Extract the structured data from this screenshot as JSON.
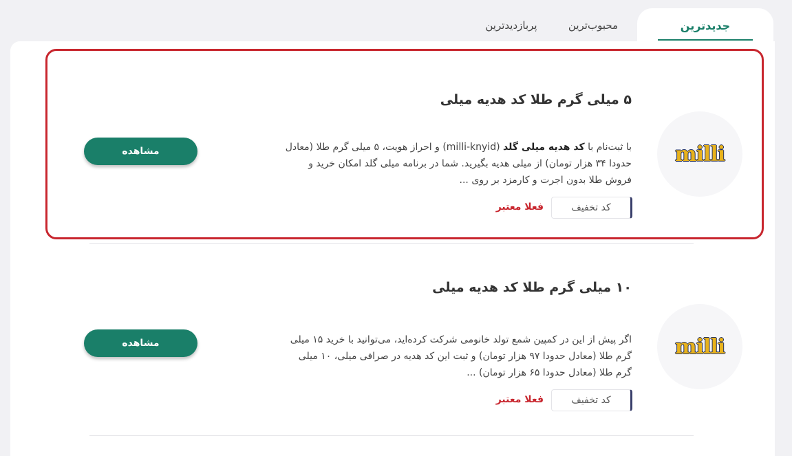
{
  "tabs": [
    {
      "label": "جدیدترین",
      "active": true
    },
    {
      "label": "محبوب‌ترین",
      "active": false
    },
    {
      "label": "پربازدیدترین",
      "active": false
    }
  ],
  "colors": {
    "accent": "#1a7f69",
    "highlight": "#c8262e",
    "status": "#c8262e"
  },
  "offers": [
    {
      "title": "۵ میلی گرم طلا کد هدیه میلی",
      "logo_text": "milli",
      "desc_pre": "با ثبت‌نام با ",
      "desc_bold": "کد هدیه میلی گلد",
      "desc_post": " (milli-knyid) و احراز هویت، ۵ میلی گرم طلا (معادل حدودا ۳۴ هزار تومان) از میلی هدیه بگیرید. شما در برنامه میلی گلد امکان خرید و فروش طلا بدون اجرت و کارمزد بر روی ...",
      "code_label": "کد تخفیف",
      "status": "فعلا معتبر",
      "button": "مشاهده"
    },
    {
      "title": "۱۰ میلی گرم طلا کد هدیه میلی",
      "logo_text": "milli",
      "desc": "اگر پیش از این در کمپین شمع تولد خانومی شرکت کرده‌اید، می‌توانید با خرید ۱۵ میلی گرم طلا (معادل حدودا ۹۷ هزار تومان) و ثبت این کد هدیه در صرافی میلی، ۱۰ میلی گرم طلا (معادل حدودا ۶۵ هزار تومان) ...",
      "code_label": "کد تخفیف",
      "status": "فعلا معتبر",
      "button": "مشاهده"
    }
  ]
}
